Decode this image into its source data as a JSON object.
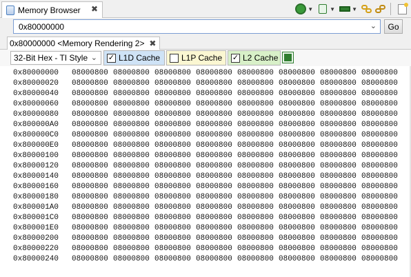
{
  "window": {
    "view_tab_title": "Memory Browser",
    "toolbar_icons": [
      "chip-gear-icon",
      "memory-view-icon",
      "memory-card-icon",
      "link-icon",
      "refresh-link-icon",
      "new-document-icon"
    ]
  },
  "address_bar": {
    "value": "0x80000000",
    "go_label": "Go"
  },
  "rendering_tab": {
    "label": "0x80000000 <Memory Rendering 2>"
  },
  "format": {
    "selected": "32-Bit Hex - TI Style"
  },
  "caches": [
    {
      "label": "L1D Cache",
      "checked": true,
      "color": "#cfe3f6"
    },
    {
      "label": "L1P Cache",
      "checked": false,
      "color": "#fbf7d2"
    },
    {
      "label": "L2 Cache",
      "checked": true,
      "color": "#d8f0c8"
    }
  ],
  "memory": {
    "rows": [
      {
        "address": "0x80000000",
        "values": [
          "08000800",
          "08000800",
          "08000800",
          "08000800",
          "08000800",
          "08000800",
          "08000800",
          "08000800"
        ]
      },
      {
        "address": "0x80000020",
        "values": [
          "08000800",
          "08000800",
          "08000800",
          "08000800",
          "08000800",
          "08000800",
          "08000800",
          "08000800"
        ]
      },
      {
        "address": "0x80000040",
        "values": [
          "08000800",
          "08000800",
          "08000800",
          "08000800",
          "08000800",
          "08000800",
          "08000800",
          "08000800"
        ]
      },
      {
        "address": "0x80000060",
        "values": [
          "08000800",
          "08000800",
          "08000800",
          "08000800",
          "08000800",
          "08000800",
          "08000800",
          "08000800"
        ]
      },
      {
        "address": "0x80000080",
        "values": [
          "08000800",
          "08000800",
          "08000800",
          "08000800",
          "08000800",
          "08000800",
          "08000800",
          "08000800"
        ]
      },
      {
        "address": "0x800000A0",
        "values": [
          "08000800",
          "08000800",
          "08000800",
          "08000800",
          "08000800",
          "08000800",
          "08000800",
          "08000800"
        ]
      },
      {
        "address": "0x800000C0",
        "values": [
          "08000800",
          "08000800",
          "08000800",
          "08000800",
          "08000800",
          "08000800",
          "08000800",
          "08000800"
        ]
      },
      {
        "address": "0x800000E0",
        "values": [
          "08000800",
          "08000800",
          "08000800",
          "08000800",
          "08000800",
          "08000800",
          "08000800",
          "08000800"
        ]
      },
      {
        "address": "0x80000100",
        "values": [
          "08000800",
          "08000800",
          "08000800",
          "08000800",
          "08000800",
          "08000800",
          "08000800",
          "08000800"
        ]
      },
      {
        "address": "0x80000120",
        "values": [
          "08000800",
          "08000800",
          "08000800",
          "08000800",
          "08000800",
          "08000800",
          "08000800",
          "08000800"
        ]
      },
      {
        "address": "0x80000140",
        "values": [
          "08000800",
          "08000800",
          "08000800",
          "08000800",
          "08000800",
          "08000800",
          "08000800",
          "08000800"
        ]
      },
      {
        "address": "0x80000160",
        "values": [
          "08000800",
          "08000800",
          "08000800",
          "08000800",
          "08000800",
          "08000800",
          "08000800",
          "08000800"
        ]
      },
      {
        "address": "0x80000180",
        "values": [
          "08000800",
          "08000800",
          "08000800",
          "08000800",
          "08000800",
          "08000800",
          "08000800",
          "08000800"
        ]
      },
      {
        "address": "0x800001A0",
        "values": [
          "08000800",
          "08000800",
          "08000800",
          "08000800",
          "08000800",
          "08000800",
          "08000800",
          "08000800"
        ]
      },
      {
        "address": "0x800001C0",
        "values": [
          "08000800",
          "08000800",
          "08000800",
          "08000800",
          "08000800",
          "08000800",
          "08000800",
          "08000800"
        ]
      },
      {
        "address": "0x800001E0",
        "values": [
          "08000800",
          "08000800",
          "08000800",
          "08000800",
          "08000800",
          "08000800",
          "08000800",
          "08000800"
        ]
      },
      {
        "address": "0x80000200",
        "values": [
          "08000800",
          "08000800",
          "08000800",
          "08000800",
          "08000800",
          "08000800",
          "08000800",
          "08000800"
        ]
      },
      {
        "address": "0x80000220",
        "values": [
          "08000800",
          "08000800",
          "08000800",
          "08000800",
          "08000800",
          "08000800",
          "08000800",
          "08000800"
        ]
      },
      {
        "address": "0x80000240",
        "values": [
          "08000800",
          "08000800",
          "08000800",
          "08000800",
          "08000800",
          "08000800",
          "08000800",
          "08000800"
        ]
      }
    ]
  }
}
